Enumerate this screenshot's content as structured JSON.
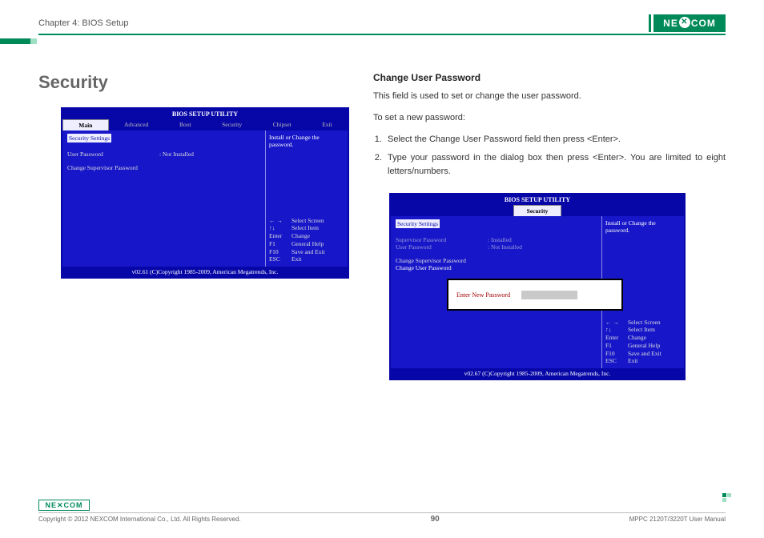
{
  "header": {
    "chapter": "Chapter 4: BIOS Setup",
    "logo_text": "NE COM",
    "logo_x": "✕"
  },
  "left": {
    "heading": "Security",
    "bios": {
      "title": "BIOS SETUP UTILITY",
      "tabs": [
        "Main",
        "Advanced",
        "Boot",
        "Security",
        "Chipset",
        "Exit"
      ],
      "active_tab": "Main",
      "section": "Security Settings",
      "row1_label": "User Password",
      "row1_value": ":  Not Installed",
      "row2": "Change Supervisor Password",
      "side_hint": "Install or Change the password.",
      "help": [
        {
          "k": "← →",
          "v": "Select Screen"
        },
        {
          "k": "↑↓",
          "v": "Select Item"
        },
        {
          "k": "Enter",
          "v": "Change"
        },
        {
          "k": "F1",
          "v": "General Help"
        },
        {
          "k": "F10",
          "v": "Save and Exit"
        },
        {
          "k": "ESC",
          "v": "Exit"
        }
      ],
      "footer": "v02.61 (C)Copyright 1985-2009, American Megatrends, Inc."
    }
  },
  "right": {
    "heading": "Change User Password",
    "para1": "This field is used to set or change the user password.",
    "para2": "To set a new password:",
    "steps": [
      "Select the Change User Password field then press <Enter>.",
      "Type your password in the dialog box then press <Enter>. You are limited to eight letters/numbers."
    ],
    "bios": {
      "title": "BIOS SETUP UTILITY",
      "active_tab_label": "Security",
      "section": "Security Settings",
      "row1_label": "Supervisor Password",
      "row1_value": ":  Installed",
      "row2_label": "User Password",
      "row2_value": ":  Not Installed",
      "row3": "Change Supervisor Password",
      "row4": "Change User Password",
      "dialog_prompt": "Enter New Password",
      "side_hint": "Install or Change the password.",
      "help": [
        {
          "k": "← →",
          "v": "Select Screen"
        },
        {
          "k": "↑↓",
          "v": "Select Item"
        },
        {
          "k": "Enter",
          "v": "Change"
        },
        {
          "k": "F1",
          "v": "General Help"
        },
        {
          "k": "F10",
          "v": "Save and Exit"
        },
        {
          "k": "ESC",
          "v": "Exit"
        }
      ],
      "footer": "v02.67 (C)Copyright 1985-2009, American Megatrends, Inc."
    }
  },
  "footer": {
    "copyright": "Copyright © 2012 NEXCOM International Co., Ltd. All Rights Reserved.",
    "page": "90",
    "manual": "MPPC 2120T/3220T User Manual",
    "logo_small": "NE✕COM"
  }
}
